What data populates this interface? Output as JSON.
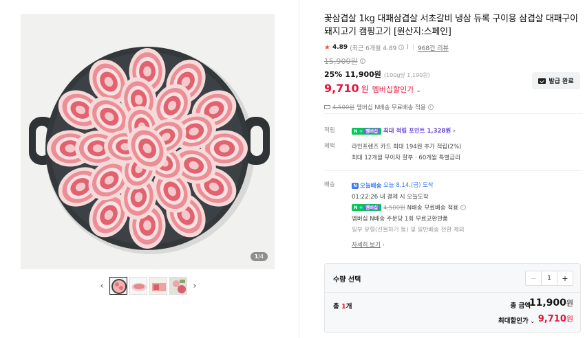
{
  "product": {
    "title": "꽃삼겹살 1kg 대패삼겹살 서초갈비 냉삼 듀록 구이용 삼겹살 대패구이 돼지고기 캠핑고기 [원산지:스페인]",
    "rating": "4.89",
    "rating_recent": "(최근 6개월 4.89",
    "reviews": "968건 리뷰",
    "original_price": "15,900원",
    "discount_rate": "25%",
    "sale_price": "11,900원",
    "unit_price": "(100g당 1,190원)",
    "member_price": "9,710",
    "member_won": "원",
    "member_label": "멤버십할인가",
    "coupon_label": "발급 완료",
    "shipping_orig": "4,500원",
    "shipping_text": "멤버십 N배송 무료배송 적용"
  },
  "gallery": {
    "counter_current": "1",
    "counter_total": "/4",
    "thumb_count": 4
  },
  "details": {
    "points_label": "적립",
    "points_badge": "N+ 멤버십",
    "points_text": "최대 적립 포인트 1,328원",
    "benefit_label": "혜택",
    "benefit_line1": "라인프렌즈 카드 최대 194원 추가 적립(2%)",
    "benefit_line2": "최대 12개월 무이자 할부 · 60개월 특별금리",
    "delivery_label": "배송",
    "delivery_badge": "오늘배송",
    "delivery_date": "오늘 8.14.(금) 도착",
    "delivery_time": "01:22:26  내 결제 시 오늘도착",
    "delivery_ship_orig": "4,500원",
    "delivery_ship_text": "N배송 무료배송 적용",
    "delivery_return": "멤버십 N배송 주문당 1회 무료교환반품",
    "delivery_exclude": "일부 유형(선물하기 등) 및 일반배송 전환 제외",
    "more_link": "자세히 보기"
  },
  "quantity": {
    "title": "수량 선택",
    "value": "1",
    "total_count_prefix": "총 ",
    "total_count_num": "1",
    "total_count_suffix": "개",
    "total_label": "총 금액",
    "total_price": "11,900",
    "max_label": "최대할인가",
    "max_price": "9,710",
    "won": "원"
  },
  "colors": {
    "accent_red": "#e6143c",
    "naver_green": "#03c75a",
    "membership_purple": "#7e5be7",
    "delivery_blue": "#3c7bf0"
  }
}
